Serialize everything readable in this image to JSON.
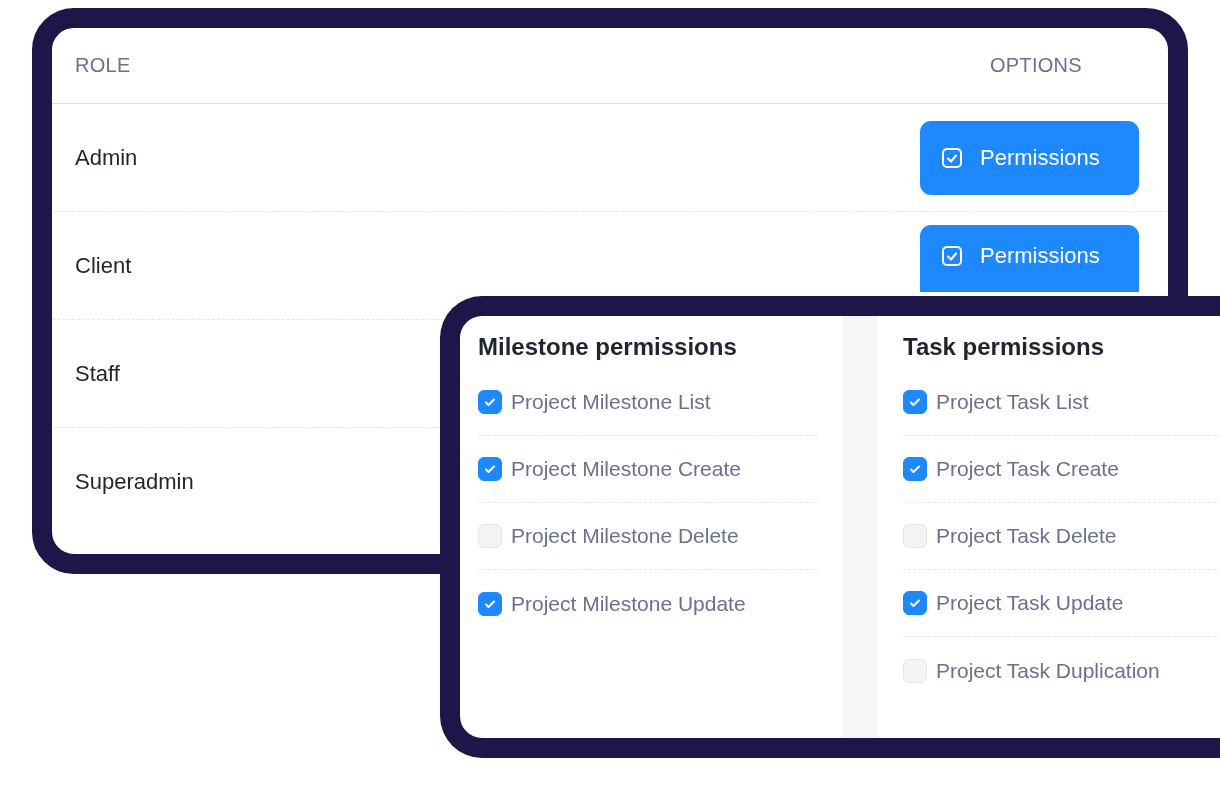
{
  "roles_table": {
    "columns": [
      "ROLE",
      "OPTIONS"
    ],
    "rows": [
      {
        "role": "Admin",
        "button": "Permissions"
      },
      {
        "role": "Client",
        "button": "Permissions"
      },
      {
        "role": "Staff"
      },
      {
        "role": "Superadmin"
      }
    ]
  },
  "permission_panel": {
    "groups": [
      {
        "title": "Milestone permissions",
        "items": [
          {
            "label": "Project Milestone List",
            "checked": true
          },
          {
            "label": "Project Milestone Create",
            "checked": true
          },
          {
            "label": "Project Milestone Delete",
            "checked": false
          },
          {
            "label": "Project Milestone Update",
            "checked": true
          }
        ]
      },
      {
        "title": "Task permissions",
        "items": [
          {
            "label": "Project Task List",
            "checked": true
          },
          {
            "label": "Project Task Create",
            "checked": true
          },
          {
            "label": "Project Task Delete",
            "checked": false
          },
          {
            "label": "Project Task Update",
            "checked": true
          },
          {
            "label": "Project Task Duplication",
            "checked": false
          }
        ]
      }
    ]
  }
}
